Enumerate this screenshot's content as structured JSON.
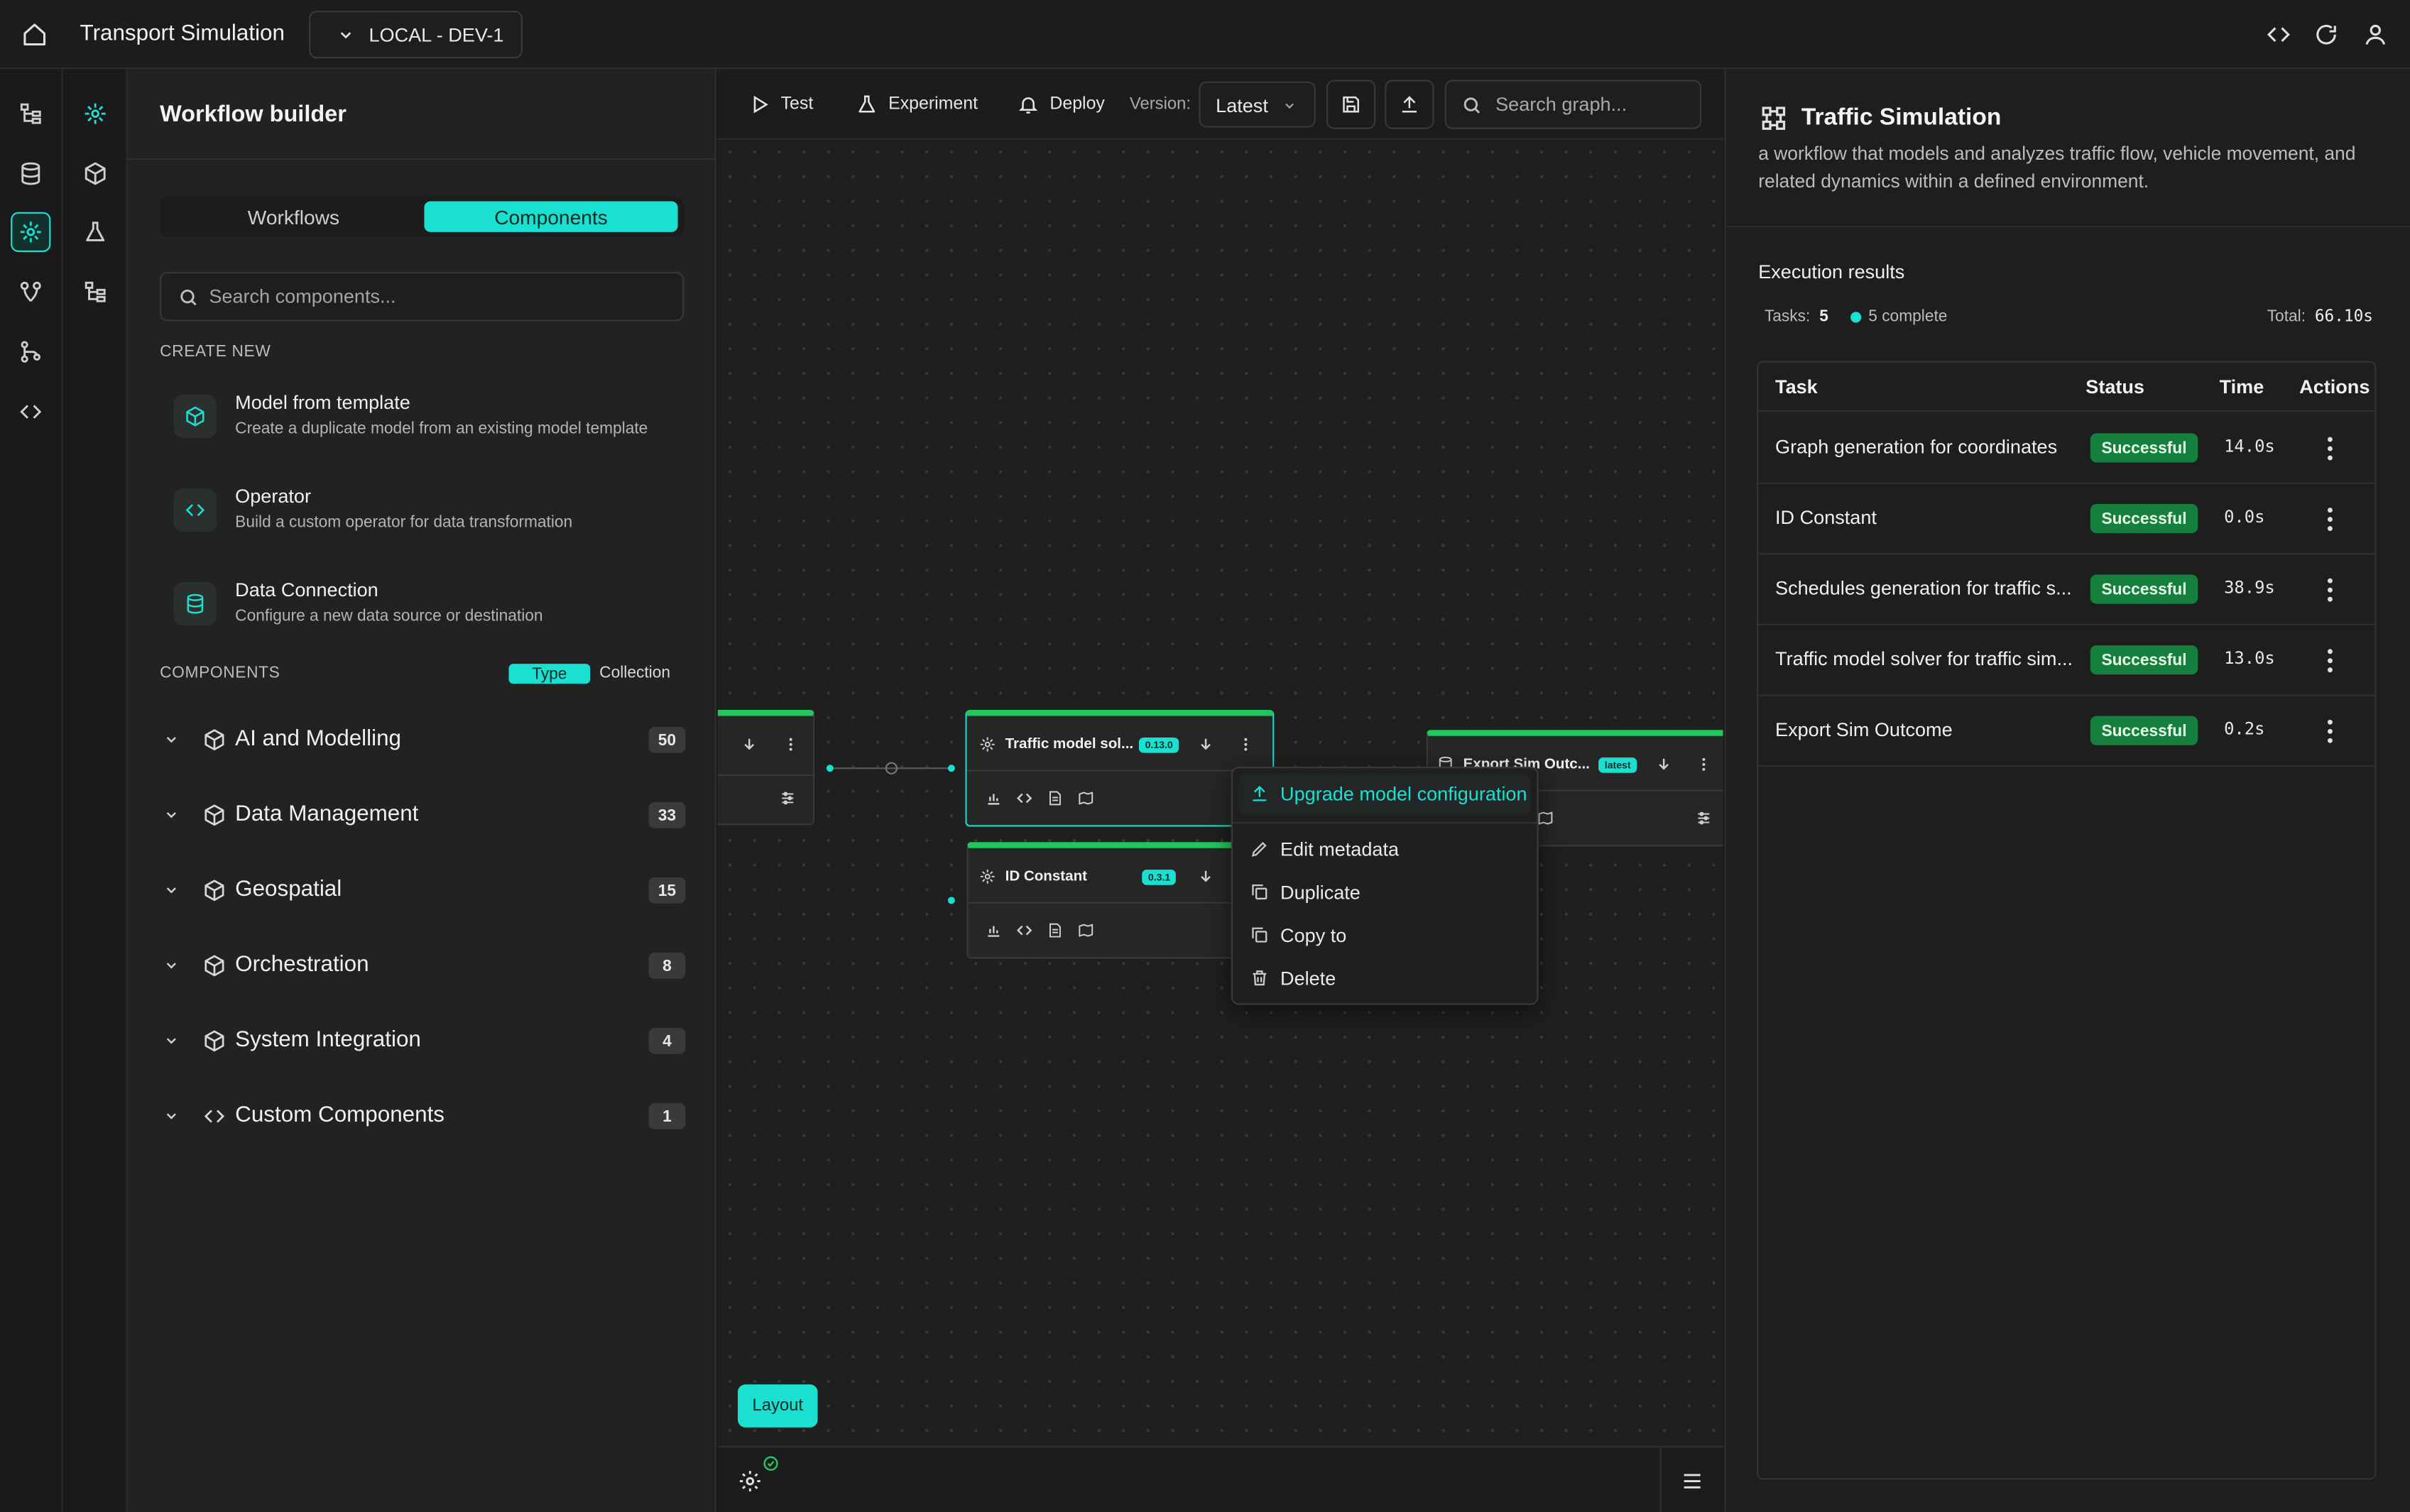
{
  "header": {
    "app_title": "Transport Simulation",
    "environment": "LOCAL - DEV-1"
  },
  "sidebar": {
    "title": "Workflow builder",
    "tabs": [
      "Workflows",
      "Components"
    ],
    "active_tab": "Components",
    "search_placeholder": "Search components...",
    "create_new_label": "CREATE NEW",
    "create_items": [
      {
        "title": "Model from template",
        "description": "Create a duplicate model from an existing model template",
        "icon": "cube-icon"
      },
      {
        "title": "Operator",
        "description": "Build a custom operator for data transformation",
        "icon": "code-icon"
      },
      {
        "title": "Data Connection",
        "description": "Configure a new data source or destination",
        "icon": "database-icon"
      }
    ],
    "components_label": "COMPONENTS",
    "view_toggle": [
      "Type",
      "Collection"
    ],
    "active_view": "Type",
    "categories": [
      {
        "label": "AI and Modelling",
        "count": "50"
      },
      {
        "label": "Data Management",
        "count": "33"
      },
      {
        "label": "Geospatial",
        "count": "15"
      },
      {
        "label": "Orchestration",
        "count": "8"
      },
      {
        "label": "System Integration",
        "count": "4"
      },
      {
        "label": "Custom Components",
        "count": "1"
      }
    ]
  },
  "toolbar": {
    "test": "Test",
    "experiment": "Experiment",
    "deploy": "Deploy",
    "version_label": "Version:",
    "version_value": "Latest",
    "search_placeholder": "Search graph..."
  },
  "canvas": {
    "nodes": [
      {
        "title": "Traffic model sol...",
        "version": "0.13.0"
      },
      {
        "title": "ID Constant",
        "version": "0.3.1"
      },
      {
        "title": "Export Sim Outc...",
        "version": "latest"
      }
    ],
    "layout_button": "Layout",
    "context_menu": [
      "Upgrade model configuration",
      "Edit metadata",
      "Duplicate",
      "Copy to",
      "Delete"
    ]
  },
  "details": {
    "title": "Traffic Simulation",
    "description": "a workflow that models and analyzes traffic flow, vehicle movement, and related dynamics within a defined environment.",
    "execution_title": "Execution results",
    "tasks_label": "Tasks:",
    "tasks_count": "5",
    "complete_text": "5 complete",
    "total_label": "Total:",
    "total_value": "66.10s",
    "columns": [
      "Task",
      "Status",
      "Time",
      "Actions"
    ],
    "rows": [
      {
        "task": "Graph generation for coordinates",
        "status": "Successful",
        "time": "14.0s"
      },
      {
        "task": "ID Constant",
        "status": "Successful",
        "time": "0.0s"
      },
      {
        "task": "Schedules generation for traffic s...",
        "status": "Successful",
        "time": "38.9s"
      },
      {
        "task": "Traffic model solver for traffic sim...",
        "status": "Successful",
        "time": "13.0s"
      },
      {
        "task": "Export Sim Outcome",
        "status": "Successful",
        "time": "0.2s"
      }
    ]
  },
  "colors": {
    "accent": "#19e0d0",
    "success": "#15803d",
    "node_border": "#22c55e",
    "background": "#1c1c1c"
  }
}
